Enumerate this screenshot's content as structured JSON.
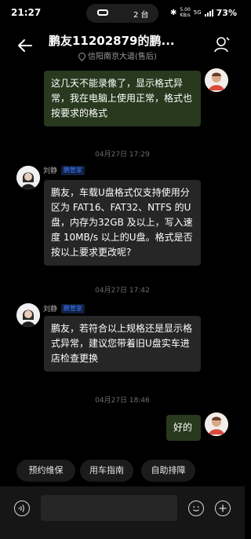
{
  "status_bar": {
    "time": "21:27",
    "device_count": "2 台",
    "network_speed_top": "5.00",
    "network_speed_bottom": "KB/s",
    "network_type": "5G",
    "battery": "73%"
  },
  "header": {
    "title": "鹏友11202879的鹏...",
    "subtitle": "信阳南京大道(售后)"
  },
  "messages": [
    {
      "type": "outgoing",
      "text": "这几天不能录像了，显示格式异常，我在电脑上使用正常，格式也按要求的格式"
    },
    {
      "type": "timestamp",
      "text": "04月27日 17:29"
    },
    {
      "type": "incoming",
      "sender": "刘静",
      "badge": "鹏管家",
      "text": "鹏友，车载U盘格式仅支持使用分区为 FAT16、FAT32、NTFS 的U盘，内存为32GB 及以上，写入速度 10MB/s 以上的U盘。格式是否按以上要求更改呢?"
    },
    {
      "type": "timestamp",
      "text": "04月27日 17:42"
    },
    {
      "type": "incoming",
      "sender": "刘静",
      "badge": "鹏管家",
      "text": "鹏友，若符合以上规格还是显示格式异常，建议您带着旧U盘实车进店检查更换"
    },
    {
      "type": "timestamp",
      "text": "04月27日 18:46"
    },
    {
      "type": "outgoing",
      "text": "好的"
    }
  ],
  "quick_replies": [
    "预约维保",
    "用车指南",
    "自助排障"
  ],
  "input": {
    "placeholder": "",
    "value": ""
  },
  "colors": {
    "background": "#000000",
    "incoming_bubble": "#262626",
    "outgoing_bubble": "#28391e",
    "badge": "#3f7cff"
  }
}
